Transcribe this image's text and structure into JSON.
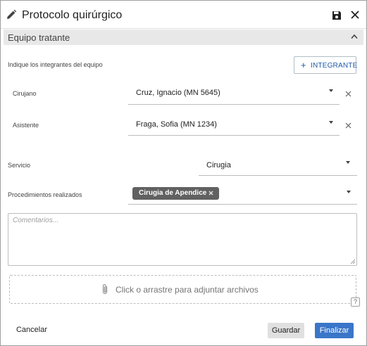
{
  "header": {
    "title": "Protocolo quirúrgico",
    "edit_icon": "pencil-icon",
    "save_icon": "floppy-disk-icon",
    "close_icon": "close-icon"
  },
  "section": {
    "title": "Equipo tratante",
    "toggle_icon": "chevron-up-icon"
  },
  "team": {
    "hint": "Indique los integrantes del equipo",
    "add_button": {
      "icon": "plus-icon",
      "label": "INTEGRANTE"
    },
    "members": [
      {
        "role": "Cirujano",
        "value": "Cruz, Ignacio (MN 5645)"
      },
      {
        "role": "Asistente",
        "value": "Fraga, Sofia (MN 1234)"
      }
    ]
  },
  "service": {
    "label": "Servicio",
    "value": "Cirugia"
  },
  "procedures": {
    "label": "Procedimientos realizados",
    "chips": [
      "Cirugia de Apendice"
    ]
  },
  "comments": {
    "placeholder": "Comentarios..."
  },
  "attachments": {
    "icon": "paperclip-icon",
    "text": "Click o arrastre para adjuntar archivos"
  },
  "help": {
    "label": "?"
  },
  "footer": {
    "cancel": "Cancelar",
    "save": "Guardar",
    "finish": "Finalizar"
  },
  "colors": {
    "primary": "#3a76c8",
    "link": "#1e5aa8",
    "section_bg": "#e8e8e8",
    "chip_bg": "#616161"
  }
}
